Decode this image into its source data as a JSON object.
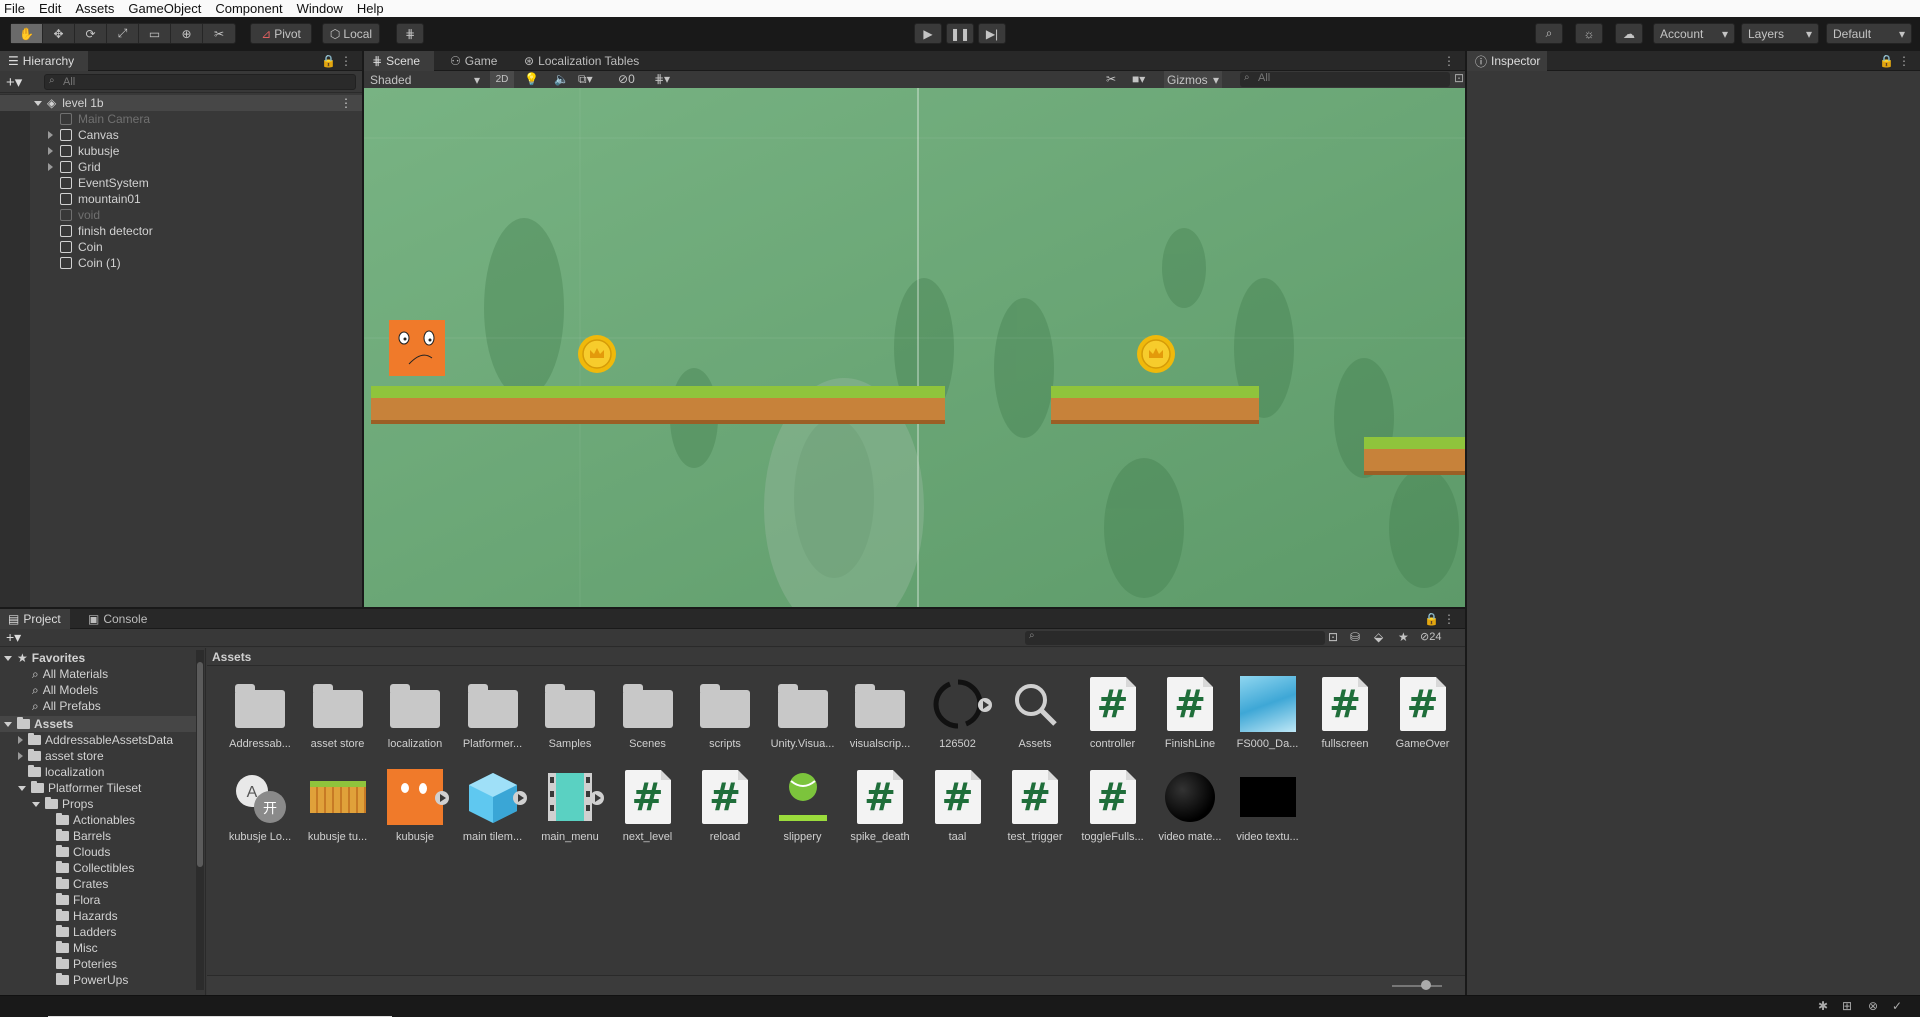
{
  "menu": [
    "File",
    "Edit",
    "Assets",
    "GameObject",
    "Component",
    "Window",
    "Help"
  ],
  "toolbar": {
    "pivot": "Pivot",
    "local": "Local",
    "account": "Account",
    "layers": "Layers",
    "layout": "Default"
  },
  "hierarchy": {
    "tab": "Hierarchy",
    "search_placeholder": "All",
    "scene": "level 1b",
    "items": [
      {
        "label": "Main Camera",
        "muted": true,
        "expandable": false
      },
      {
        "label": "Canvas",
        "muted": false,
        "expandable": true
      },
      {
        "label": "kubusje",
        "muted": false,
        "expandable": true
      },
      {
        "label": "Grid",
        "muted": false,
        "expandable": true
      },
      {
        "label": "EventSystem",
        "muted": false,
        "expandable": false
      },
      {
        "label": "mountain01",
        "muted": false,
        "expandable": false
      },
      {
        "label": "void",
        "muted": true,
        "expandable": false
      },
      {
        "label": "finish detector",
        "muted": false,
        "expandable": false
      },
      {
        "label": "Coin",
        "muted": false,
        "expandable": false
      },
      {
        "label": "Coin (1)",
        "muted": false,
        "expandable": false
      }
    ]
  },
  "scene": {
    "tabs": [
      "Scene",
      "Game",
      "Localization Tables"
    ],
    "shading": "Shaded",
    "mode_2d": "2D",
    "hidden_count": "0",
    "gizmos": "Gizmos",
    "search_placeholder": "All"
  },
  "inspector": {
    "tab": "Inspector"
  },
  "project": {
    "tabs": [
      "Project",
      "Console"
    ],
    "count": "24",
    "breadcrumb": "Assets",
    "favorites_label": "Favorites",
    "favorites": [
      "All Materials",
      "All Models",
      "All Prefabs"
    ],
    "assets_label": "Assets",
    "tree": [
      {
        "label": "AddressableAssetsData",
        "depth": 1,
        "arrow": "right"
      },
      {
        "label": "asset store",
        "depth": 1,
        "arrow": "right"
      },
      {
        "label": "localization",
        "depth": 1,
        "arrow": "none"
      },
      {
        "label": "Platformer Tileset",
        "depth": 1,
        "arrow": "down"
      },
      {
        "label": "Props",
        "depth": 2,
        "arrow": "down"
      },
      {
        "label": "Actionables",
        "depth": 3,
        "arrow": "none"
      },
      {
        "label": "Barrels",
        "depth": 3,
        "arrow": "none"
      },
      {
        "label": "Clouds",
        "depth": 3,
        "arrow": "none"
      },
      {
        "label": "Collectibles",
        "depth": 3,
        "arrow": "none"
      },
      {
        "label": "Crates",
        "depth": 3,
        "arrow": "none"
      },
      {
        "label": "Flora",
        "depth": 3,
        "arrow": "none"
      },
      {
        "label": "Hazards",
        "depth": 3,
        "arrow": "none"
      },
      {
        "label": "Ladders",
        "depth": 3,
        "arrow": "none"
      },
      {
        "label": "Misc",
        "depth": 3,
        "arrow": "none"
      },
      {
        "label": "Poteries",
        "depth": 3,
        "arrow": "none"
      },
      {
        "label": "PowerUps",
        "depth": 3,
        "arrow": "none"
      }
    ],
    "grid_row1": [
      {
        "label": "Addressab...",
        "kind": "folder"
      },
      {
        "label": "asset store",
        "kind": "folder"
      },
      {
        "label": "localization",
        "kind": "folder"
      },
      {
        "label": "Platformer...",
        "kind": "folder"
      },
      {
        "label": "Samples",
        "kind": "folder"
      },
      {
        "label": "Scenes",
        "kind": "folder"
      },
      {
        "label": "scripts",
        "kind": "folder"
      },
      {
        "label": "Unity.Visua...",
        "kind": "folder"
      },
      {
        "label": "visualscrip...",
        "kind": "folder"
      },
      {
        "label": "126502",
        "kind": "refresh"
      },
      {
        "label": "Assets",
        "kind": "search"
      },
      {
        "label": "controller",
        "kind": "script"
      },
      {
        "label": "FinishLine",
        "kind": "script"
      },
      {
        "label": "FS000_Da...",
        "kind": "sky"
      },
      {
        "label": "fullscreen",
        "kind": "script"
      },
      {
        "label": "GameOver",
        "kind": "script"
      }
    ],
    "grid_row2": [
      {
        "label": "kubusje Lo...",
        "kind": "locale"
      },
      {
        "label": "kubusje tu...",
        "kind": "tiles"
      },
      {
        "label": "kubusje",
        "kind": "kubusje"
      },
      {
        "label": "main tilem...",
        "kind": "cube"
      },
      {
        "label": "main_menu",
        "kind": "film"
      },
      {
        "label": "next_level",
        "kind": "script"
      },
      {
        "label": "reload",
        "kind": "script"
      },
      {
        "label": "slippery",
        "kind": "ball"
      },
      {
        "label": "spike_death",
        "kind": "script"
      },
      {
        "label": "taal",
        "kind": "script"
      },
      {
        "label": "test_trigger",
        "kind": "script"
      },
      {
        "label": "toggleFulls...",
        "kind": "script"
      },
      {
        "label": "video mate...",
        "kind": "sphere"
      },
      {
        "label": "video textu...",
        "kind": "black"
      }
    ]
  },
  "colors": {
    "scene_bg": "#6da876",
    "coin": "#f0b90b",
    "player": "#f07a2a",
    "grass": "#8fc43c",
    "dirt": "#c7823a",
    "script_hash": "#1f6e3a"
  }
}
